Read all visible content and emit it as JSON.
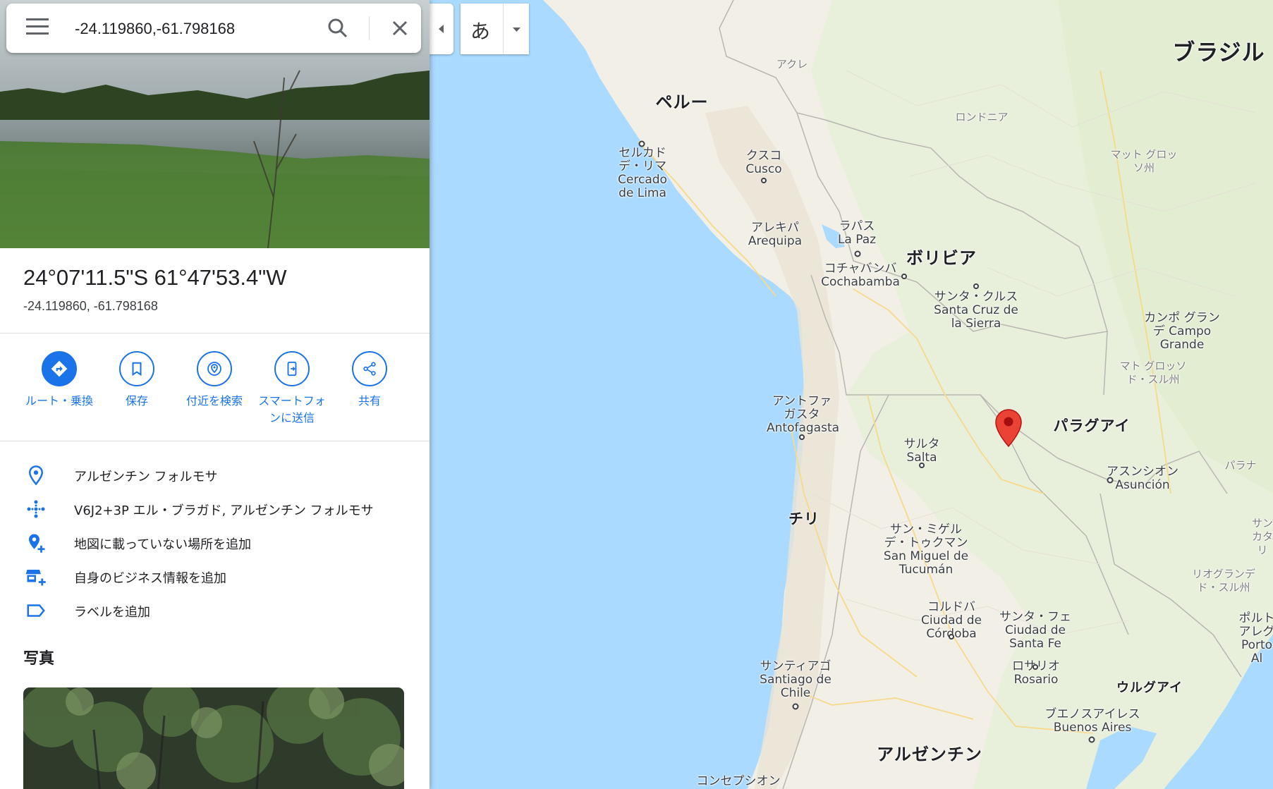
{
  "search": {
    "query": "-24.119860,-61.798168"
  },
  "place": {
    "title": "24°07'11.5\"S 61°47'53.4\"W",
    "subtitle": "-24.119860, -61.798168"
  },
  "actions": [
    {
      "label": "ルート・乗換",
      "icon": "directions-icon"
    },
    {
      "label": "保存",
      "icon": "bookmark-icon"
    },
    {
      "label": "付近を検索",
      "icon": "nearby-icon"
    },
    {
      "label": "スマートフォンに送信",
      "icon": "send-to-phone-icon"
    },
    {
      "label": "共有",
      "icon": "share-icon"
    }
  ],
  "info": [
    {
      "text": "アルゼンチン フォルモサ",
      "icon": "location-pin-icon"
    },
    {
      "text": "V6J2+3P エル・ブラガド, アルゼンチン フォルモサ",
      "icon": "plus-code-icon"
    },
    {
      "text": "地図に載っていない場所を追加",
      "icon": "add-place-icon"
    },
    {
      "text": "自身のビジネス情報を追加",
      "icon": "add-business-icon"
    },
    {
      "text": "ラベルを追加",
      "icon": "label-icon"
    }
  ],
  "photos_heading": "写真",
  "map_controls": {
    "language_char": "あ"
  },
  "map_labels": {
    "countries": {
      "brazil": "ブラジル",
      "peru": "ペルー",
      "bolivia": "ボリビア",
      "paraguay": "パラグアイ",
      "chile": "チリ",
      "argentina": "アルゼンチン",
      "uruguay": "ウルグアイ"
    },
    "regions": {
      "acre": "アクレ",
      "rondonia": "ロンドニア",
      "mato_grosso": "マット グロッソ州",
      "mato_grosso_sul": "マト グロッソ ド・スル州",
      "parana": "パラナ",
      "santa_catarina": "サン カタリ",
      "rio_grande_sul": "リオグランデ ド・スル州"
    },
    "cities": {
      "lima": "セルカド デ・リマ Cercado de Lima",
      "cusco": "クスコ Cusco",
      "arequipa": "アレキパ Arequipa",
      "lapaz": "ラパス La Paz",
      "cochabamba": "コチャバンバ Cochabamba",
      "santacruz": "サンタ・クルス Santa Cruz de la Sierra",
      "campogrande": "カンポ グランデ Campo Grande",
      "antofagasta": "アントファ ガスタ Antofagasta",
      "salta": "サルタ Salta",
      "asuncion": "アスンシオン Asunción",
      "tucuman": "サン・ミゲル デ・トゥクマン San Miguel de Tucumán",
      "cordoba": "コルドバ Ciudad de Córdoba",
      "santafe": "サンタ・フェ Ciudad de Santa Fe",
      "rosario": "ロサリオ Rosario",
      "santiago": "サンティアゴ Santiago de Chile",
      "buenosaires": "ブエノスアイレス Buenos Aires",
      "portoalegre": "ポルト アレグ Porto Al",
      "concepcion": "コンセプシオン"
    }
  }
}
